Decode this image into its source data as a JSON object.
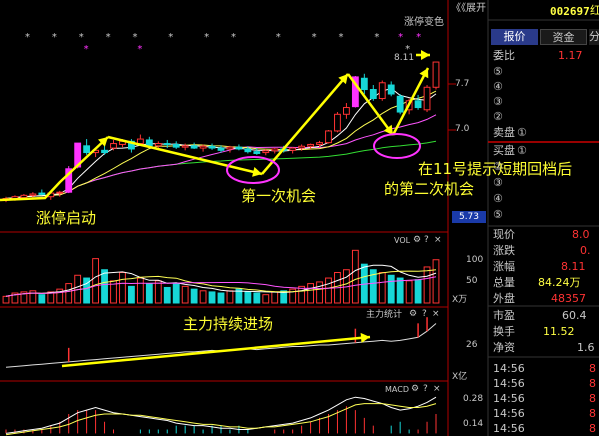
{
  "colors": {
    "up": "#ff3333",
    "down": "#17d7d7",
    "limit_up": "#ff33ff",
    "yellow": "#ffff00",
    "axis": "#b00000",
    "ma5": "#ffffff",
    "ma10": "#ffff55",
    "ma20": "#ff55ff",
    "ma60": "#33dd33",
    "annotation_ring": "#ff33ff"
  },
  "header": {
    "stock_code": "002697",
    "stock_name_partial": "红",
    "expand_label": "展开",
    "collapse_glyph": "《《"
  },
  "tabs": {
    "quote": "报价",
    "funds": "资金",
    "partial": "分"
  },
  "price_panel": {
    "signal_label": "涨停变色",
    "price_marker": "8.11",
    "scale": [
      "7.7",
      "7.0"
    ],
    "current_price_box": "5.73"
  },
  "indicator_labels": {
    "vol": "VOL",
    "vol_scale": [
      "100",
      "50"
    ],
    "vol_unit": "X万",
    "mainforce": "主力统计",
    "mainforce_scale": "26",
    "mainforce_unit": "X亿",
    "macd": "MACD",
    "macd_scale": [
      "0.28",
      "0.14"
    ]
  },
  "annotations": {
    "limit_up_start": "涨停启动",
    "first_chance": "第一次机会",
    "second_chance_line1": "在11号提示短期回档后",
    "second_chance_line2": "的第二次机会",
    "mainforce_in": "主力持续进场"
  },
  "orderbook": {
    "weibi_label": "委比",
    "weibi_value": "1.17",
    "sell_label": "卖盘",
    "buy_label": "买盘",
    "sell_levels": [
      "⑤",
      "④",
      "③",
      "②",
      "①"
    ],
    "buy_levels": [
      "①",
      "②",
      "③",
      "④",
      "⑤"
    ]
  },
  "quote_stats": [
    {
      "label": "现价",
      "value": "8.0"
    },
    {
      "label": "涨跌",
      "value": "0."
    },
    {
      "label": "涨幅",
      "value": "8.11"
    },
    {
      "label": "总量",
      "value": "84.24万"
    },
    {
      "label": "外盘",
      "value": "48357"
    }
  ],
  "fund_stats": [
    {
      "label": "市盈",
      "value": "60.4"
    },
    {
      "label": "换手",
      "value": "11.52"
    },
    {
      "label": "净资",
      "value": "1.6"
    }
  ],
  "ticks": [
    {
      "time": "14:56",
      "value": "8"
    },
    {
      "time": "14:56",
      "value": "8"
    },
    {
      "time": "14:56",
      "value": "8"
    },
    {
      "time": "14:56",
      "value": "8"
    },
    {
      "time": "14:56",
      "value": "8"
    }
  ],
  "chart_data": {
    "type": "candlestick",
    "price_axis_labels": [
      "7.7",
      "7.0"
    ],
    "candles": [
      {
        "o": 5.05,
        "h": 5.12,
        "l": 5.0,
        "c": 5.08
      },
      {
        "o": 5.08,
        "h": 5.15,
        "l": 5.03,
        "c": 5.12
      },
      {
        "o": 5.1,
        "h": 5.18,
        "l": 5.06,
        "c": 5.15
      },
      {
        "o": 5.15,
        "h": 5.22,
        "l": 5.1,
        "c": 5.18
      },
      {
        "o": 5.2,
        "h": 5.28,
        "l": 5.15,
        "c": 5.17
      },
      {
        "o": 5.12,
        "h": 5.22,
        "l": 5.05,
        "c": 5.2
      },
      {
        "o": 5.2,
        "h": 5.25,
        "l": 5.12,
        "c": 5.22
      },
      {
        "o": 5.22,
        "h": 5.8,
        "l": 5.2,
        "c": 5.74
      },
      {
        "o": 5.78,
        "h": 6.3,
        "l": 5.75,
        "c": 6.31
      },
      {
        "o": 6.25,
        "h": 6.4,
        "l": 6.05,
        "c": 6.1
      },
      {
        "o": 6.1,
        "h": 6.2,
        "l": 6.0,
        "c": 6.15
      },
      {
        "o": 6.15,
        "h": 6.25,
        "l": 6.05,
        "c": 6.1
      },
      {
        "o": 6.2,
        "h": 6.38,
        "l": 6.15,
        "c": 6.3
      },
      {
        "o": 6.28,
        "h": 6.4,
        "l": 6.22,
        "c": 6.35
      },
      {
        "o": 6.35,
        "h": 6.4,
        "l": 6.1,
        "c": 6.18
      },
      {
        "o": 6.3,
        "h": 6.5,
        "l": 6.25,
        "c": 6.4
      },
      {
        "o": 6.38,
        "h": 6.45,
        "l": 6.2,
        "c": 6.25
      },
      {
        "o": 6.25,
        "h": 6.35,
        "l": 6.15,
        "c": 6.3
      },
      {
        "o": 6.3,
        "h": 6.38,
        "l": 6.2,
        "c": 6.28
      },
      {
        "o": 6.28,
        "h": 6.35,
        "l": 6.18,
        "c": 6.22
      },
      {
        "o": 6.22,
        "h": 6.3,
        "l": 6.15,
        "c": 6.25
      },
      {
        "o": 6.25,
        "h": 6.32,
        "l": 6.18,
        "c": 6.2
      },
      {
        "o": 6.2,
        "h": 6.28,
        "l": 6.12,
        "c": 6.24
      },
      {
        "o": 6.24,
        "h": 6.3,
        "l": 6.16,
        "c": 6.2
      },
      {
        "o": 6.2,
        "h": 6.26,
        "l": 6.1,
        "c": 6.15
      },
      {
        "o": 6.18,
        "h": 6.25,
        "l": 6.1,
        "c": 6.22
      },
      {
        "o": 6.22,
        "h": 6.28,
        "l": 6.15,
        "c": 6.18
      },
      {
        "o": 6.18,
        "h": 6.24,
        "l": 6.08,
        "c": 6.12
      },
      {
        "o": 6.12,
        "h": 6.2,
        "l": 6.05,
        "c": 6.08
      },
      {
        "o": 6.1,
        "h": 6.18,
        "l": 6.04,
        "c": 6.14
      },
      {
        "o": 6.14,
        "h": 6.2,
        "l": 6.08,
        "c": 6.18
      },
      {
        "o": 6.18,
        "h": 6.25,
        "l": 6.1,
        "c": 6.15
      },
      {
        "o": 6.15,
        "h": 6.22,
        "l": 6.08,
        "c": 6.2
      },
      {
        "o": 6.2,
        "h": 6.28,
        "l": 6.14,
        "c": 6.24
      },
      {
        "o": 6.24,
        "h": 6.3,
        "l": 6.18,
        "c": 6.28
      },
      {
        "o": 6.28,
        "h": 6.36,
        "l": 6.22,
        "c": 6.32
      },
      {
        "o": 6.32,
        "h": 6.6,
        "l": 6.3,
        "c": 6.58
      },
      {
        "o": 6.58,
        "h": 7.0,
        "l": 6.55,
        "c": 6.95
      },
      {
        "o": 6.95,
        "h": 7.2,
        "l": 6.85,
        "c": 7.1
      },
      {
        "o": 7.12,
        "h": 7.8,
        "l": 7.1,
        "c": 7.78
      },
      {
        "o": 7.75,
        "h": 7.85,
        "l": 7.4,
        "c": 7.5
      },
      {
        "o": 7.5,
        "h": 7.6,
        "l": 7.25,
        "c": 7.3
      },
      {
        "o": 7.3,
        "h": 7.7,
        "l": 7.25,
        "c": 7.65
      },
      {
        "o": 7.6,
        "h": 7.68,
        "l": 7.35,
        "c": 7.4
      },
      {
        "o": 7.35,
        "h": 7.4,
        "l": 6.95,
        "c": 7.0
      },
      {
        "o": 7.05,
        "h": 7.3,
        "l": 6.95,
        "c": 7.25
      },
      {
        "o": 7.25,
        "h": 7.38,
        "l": 7.05,
        "c": 7.1
      },
      {
        "o": 7.05,
        "h": 7.6,
        "l": 7.0,
        "c": 7.55
      },
      {
        "o": 7.55,
        "h": 8.11,
        "l": 7.5,
        "c": 8.11
      }
    ],
    "volume_bars": [
      12,
      18,
      20,
      22,
      15,
      20,
      25,
      35,
      50,
      45,
      80,
      60,
      40,
      55,
      30,
      45,
      35,
      40,
      28,
      35,
      30,
      25,
      22,
      20,
      18,
      22,
      25,
      20,
      18,
      15,
      20,
      22,
      25,
      30,
      35,
      38,
      45,
      55,
      60,
      95,
      70,
      60,
      55,
      50,
      45,
      40,
      42,
      65,
      78
    ],
    "mainforce_line": [
      1,
      2,
      3,
      4,
      5,
      6,
      7,
      8,
      9,
      10,
      11,
      12,
      13,
      14,
      15,
      16,
      17,
      18,
      19,
      20,
      21,
      21,
      22,
      23,
      22,
      23,
      24,
      25,
      24,
      25,
      26,
      27,
      28,
      28,
      29,
      30,
      30,
      31,
      32,
      33,
      34,
      35,
      36,
      35,
      36,
      38,
      40,
      48,
      58
    ],
    "macd_lines": {
      "dif": [
        0.02,
        0.03,
        0.04,
        0.05,
        0.06,
        0.08,
        0.1,
        0.14,
        0.18,
        0.2,
        0.22,
        0.2,
        0.18,
        0.17,
        0.16,
        0.15,
        0.14,
        0.13,
        0.12,
        0.1,
        0.09,
        0.08,
        0.08,
        0.07,
        0.06,
        0.06,
        0.05,
        0.05,
        0.06,
        0.07,
        0.08,
        0.09,
        0.1,
        0.12,
        0.14,
        0.17,
        0.2,
        0.24,
        0.28,
        0.3,
        0.29,
        0.27,
        0.25,
        0.22,
        0.2,
        0.21,
        0.23,
        0.26,
        0.3
      ],
      "dea": [
        0.01,
        0.02,
        0.03,
        0.04,
        0.05,
        0.06,
        0.07,
        0.09,
        0.12,
        0.14,
        0.16,
        0.17,
        0.17,
        0.17,
        0.16,
        0.16,
        0.15,
        0.14,
        0.13,
        0.12,
        0.11,
        0.1,
        0.09,
        0.09,
        0.08,
        0.07,
        0.07,
        0.06,
        0.06,
        0.07,
        0.07,
        0.08,
        0.09,
        0.1,
        0.11,
        0.13,
        0.15,
        0.18,
        0.21,
        0.24,
        0.25,
        0.25,
        0.25,
        0.24,
        0.23,
        0.22,
        0.22,
        0.23,
        0.25
      ]
    }
  }
}
